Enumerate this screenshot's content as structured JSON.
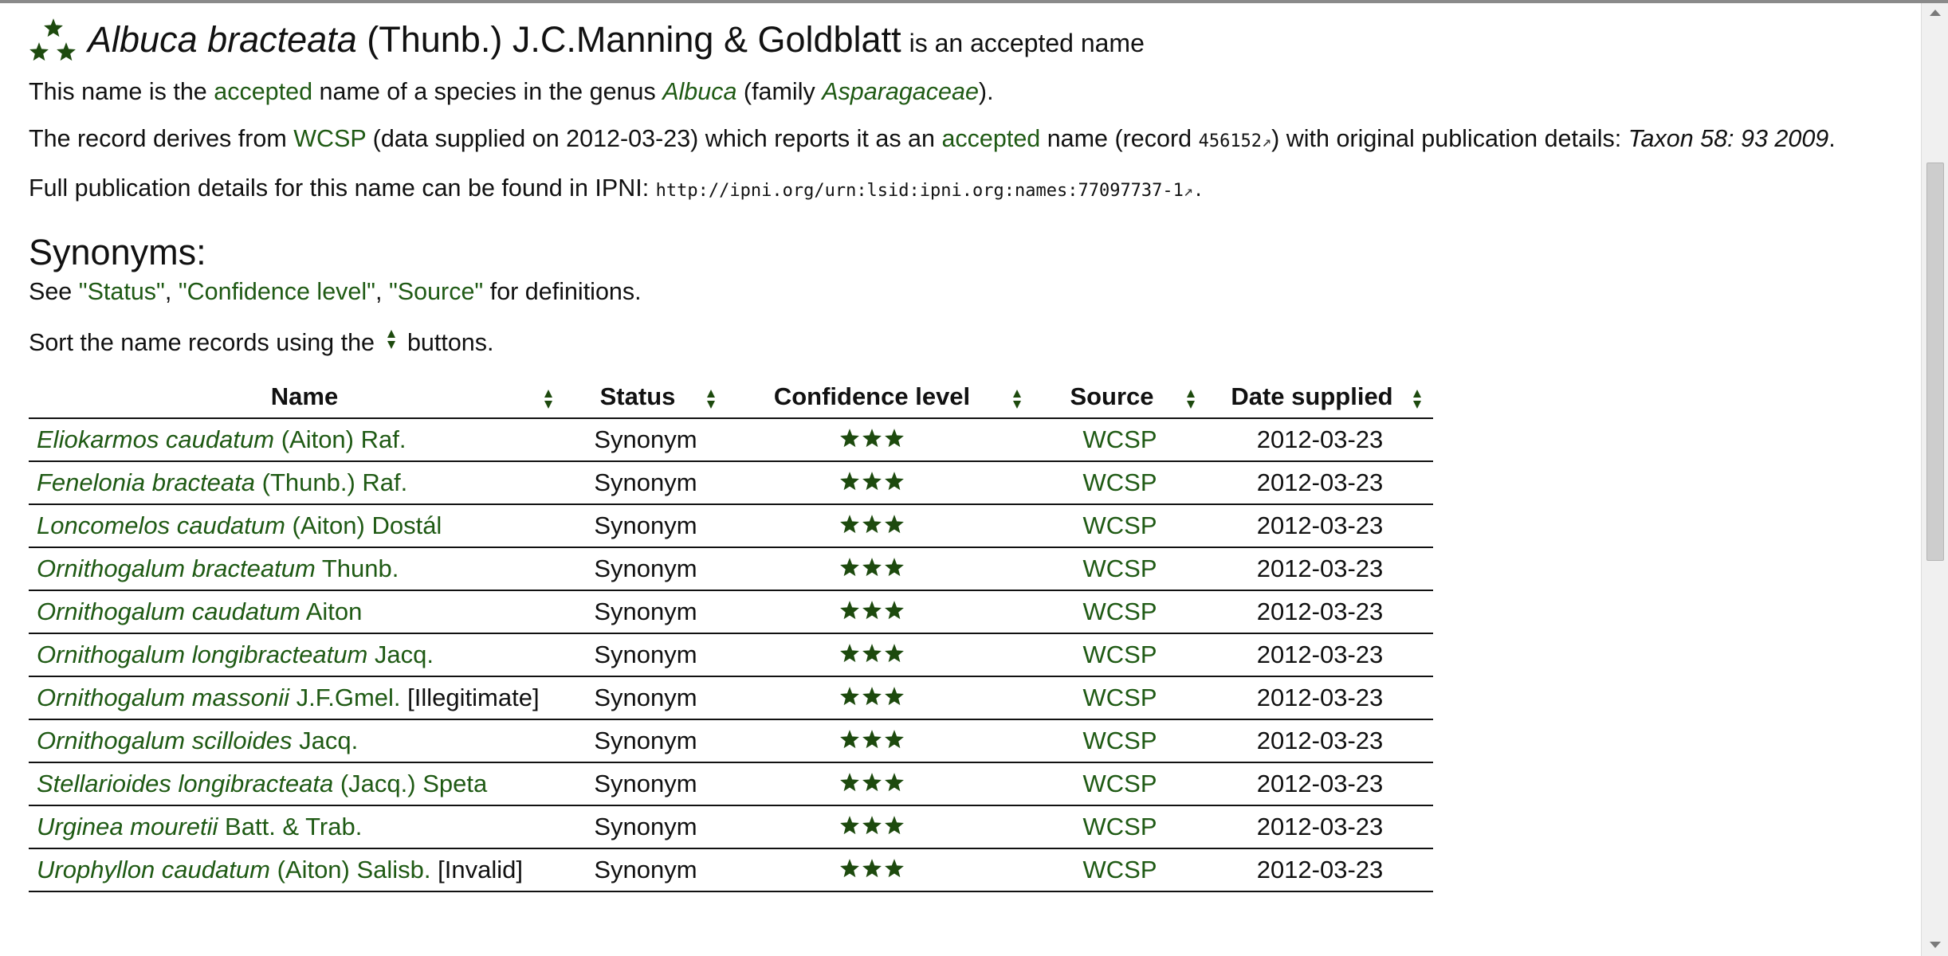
{
  "title": {
    "genus": "Albuca",
    "species": "bracteata",
    "authors": "(Thunb.) J.C.Manning & Goldblatt",
    "suffix": "is an accepted name"
  },
  "para1": {
    "t1": "This name is the ",
    "accepted_link": "accepted",
    "t2": " name of a species in the genus ",
    "genus_link": "Albuca",
    "t3": " (family ",
    "family_link": "Asparagaceae",
    "t4": ")."
  },
  "para2": {
    "t1": "The record derives from ",
    "wcsp_link": "WCSP",
    "t2": " (data supplied on 2012-03-23) which reports it as an ",
    "accepted_link": "accepted",
    "t3": " name (record ",
    "record_link": "456152",
    "t4": ") with original publication details: ",
    "publication": "Taxon 58: 93 2009",
    "t5": "."
  },
  "para3": {
    "t1": "Full publication details for this name can be found in IPNI: ",
    "ipni_link": "http://ipni.org/urn:lsid:ipni.org:names:77097737-1",
    "t2": "."
  },
  "synonyms": {
    "heading": "Synonyms:",
    "see": {
      "t1": "See ",
      "status_link": "\"Status\"",
      "t2": ", ",
      "confidence_link": "\"Confidence level\"",
      "t3": ", ",
      "source_link": "\"Source\"",
      "t4": " for definitions."
    },
    "sort": {
      "t1": "Sort the name records using the ",
      "t2": " buttons."
    }
  },
  "table": {
    "headers": {
      "name": "Name",
      "status": "Status",
      "confidence": "Confidence level",
      "source": "Source",
      "date": "Date supplied"
    },
    "rows": [
      {
        "italic": "Eliokarmos caudatum",
        "auth": " (Aiton) Raf.",
        "extra": "",
        "status": "Synonym",
        "stars": 3,
        "source": "WCSP",
        "date": "2012-03-23"
      },
      {
        "italic": "Fenelonia bracteata",
        "auth": " (Thunb.) Raf.",
        "extra": "",
        "status": "Synonym",
        "stars": 3,
        "source": "WCSP",
        "date": "2012-03-23"
      },
      {
        "italic": "Loncomelos caudatum",
        "auth": " (Aiton) Dostál",
        "extra": "",
        "status": "Synonym",
        "stars": 3,
        "source": "WCSP",
        "date": "2012-03-23"
      },
      {
        "italic": "Ornithogalum bracteatum",
        "auth": " Thunb.",
        "extra": "",
        "status": "Synonym",
        "stars": 3,
        "source": "WCSP",
        "date": "2012-03-23"
      },
      {
        "italic": "Ornithogalum caudatum",
        "auth": " Aiton",
        "extra": "",
        "status": "Synonym",
        "stars": 3,
        "source": "WCSP",
        "date": "2012-03-23"
      },
      {
        "italic": "Ornithogalum longibracteatum",
        "auth": " Jacq.",
        "extra": "",
        "status": "Synonym",
        "stars": 3,
        "source": "WCSP",
        "date": "2012-03-23"
      },
      {
        "italic": "Ornithogalum massonii",
        "auth": " J.F.Gmel.",
        "extra": " [Illegitimate]",
        "status": "Synonym",
        "stars": 3,
        "source": "WCSP",
        "date": "2012-03-23"
      },
      {
        "italic": "Ornithogalum scilloides",
        "auth": " Jacq.",
        "extra": "",
        "status": "Synonym",
        "stars": 3,
        "source": "WCSP",
        "date": "2012-03-23"
      },
      {
        "italic": "Stellarioides longibracteata",
        "auth": " (Jacq.) Speta",
        "extra": "",
        "status": "Synonym",
        "stars": 3,
        "source": "WCSP",
        "date": "2012-03-23"
      },
      {
        "italic": "Urginea mouretii",
        "auth": " Batt. & Trab.",
        "extra": "",
        "status": "Synonym",
        "stars": 3,
        "source": "WCSP",
        "date": "2012-03-23"
      },
      {
        "italic": "Urophyllon caudatum",
        "auth": " (Aiton) Salisb.",
        "extra": " [Invalid]",
        "status": "Synonym",
        "stars": 3,
        "source": "WCSP",
        "date": "2012-03-23"
      }
    ]
  },
  "colors": {
    "link": "#1f5a14",
    "star": "#1d4a0e",
    "text": "#111111"
  },
  "icons": {
    "accepted_marker": "three-star-cluster-icon",
    "sort": "sort-arrows-icon",
    "external": "external-link-icon",
    "confidence": "star-icon"
  }
}
